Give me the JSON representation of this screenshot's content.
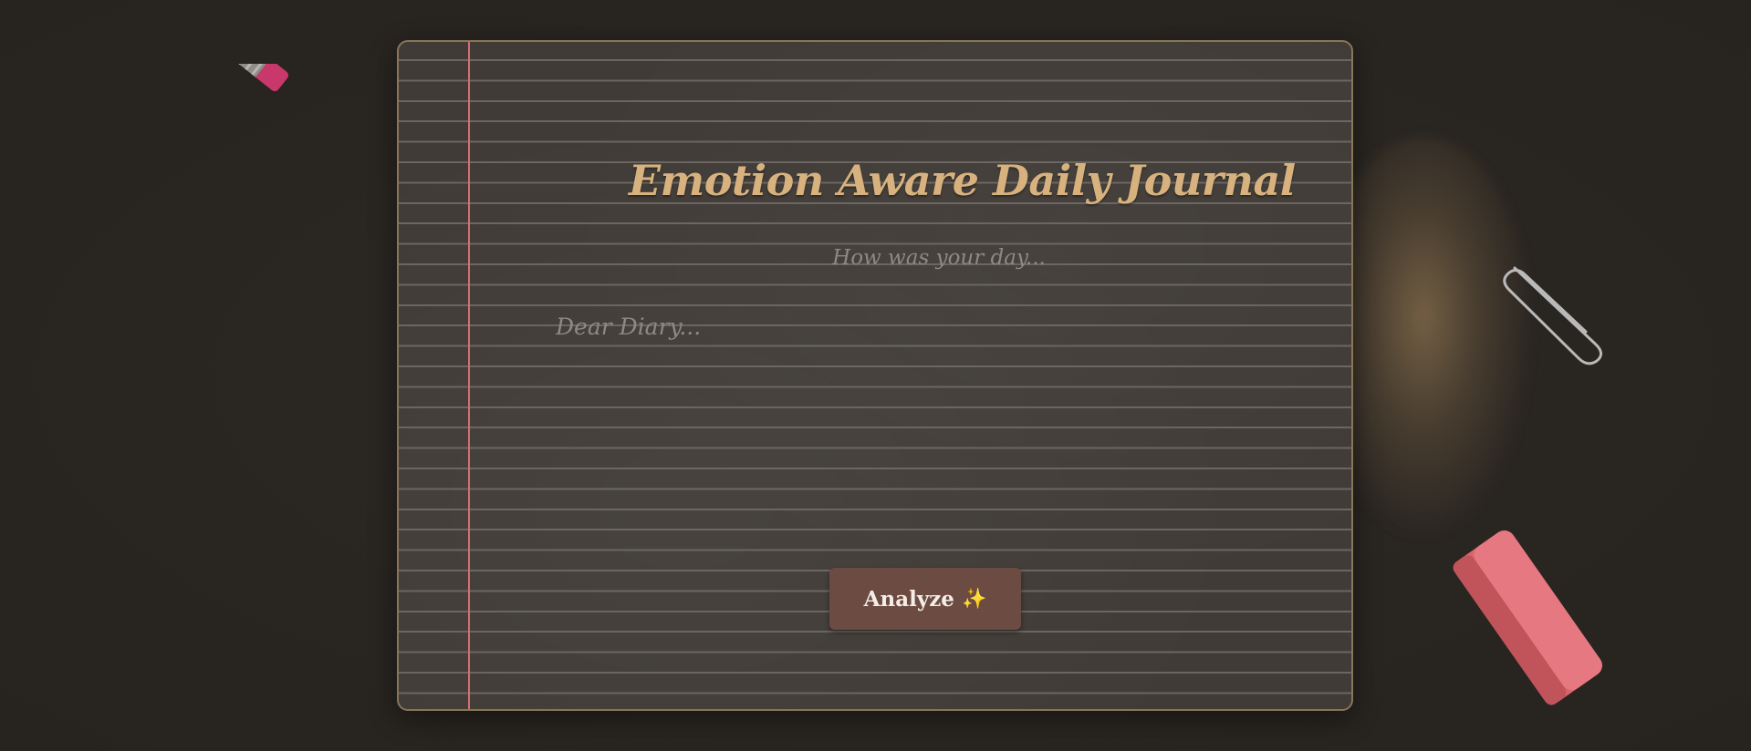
{
  "journal": {
    "title": "Emotion Aware Daily Journal",
    "subtitle": "How was your day...",
    "entry_placeholder": "Dear Diary...",
    "entry_value": ""
  },
  "actions": {
    "analyze_label": "Analyze",
    "analyze_icon": "sparkles-icon"
  },
  "icons": {
    "title_icon": "notebook-icon",
    "decor": [
      "pencil-icon",
      "paperclip-icon",
      "eraser-icon"
    ]
  },
  "colors": {
    "background": "#2a2622",
    "paper": "#403b36",
    "paper_border": "#8a7558",
    "margin_line": "#d46f73",
    "title": "#d8b27e",
    "muted_text": "#8e8984",
    "button": "#6b4b42",
    "button_text": "#f4ede6"
  }
}
